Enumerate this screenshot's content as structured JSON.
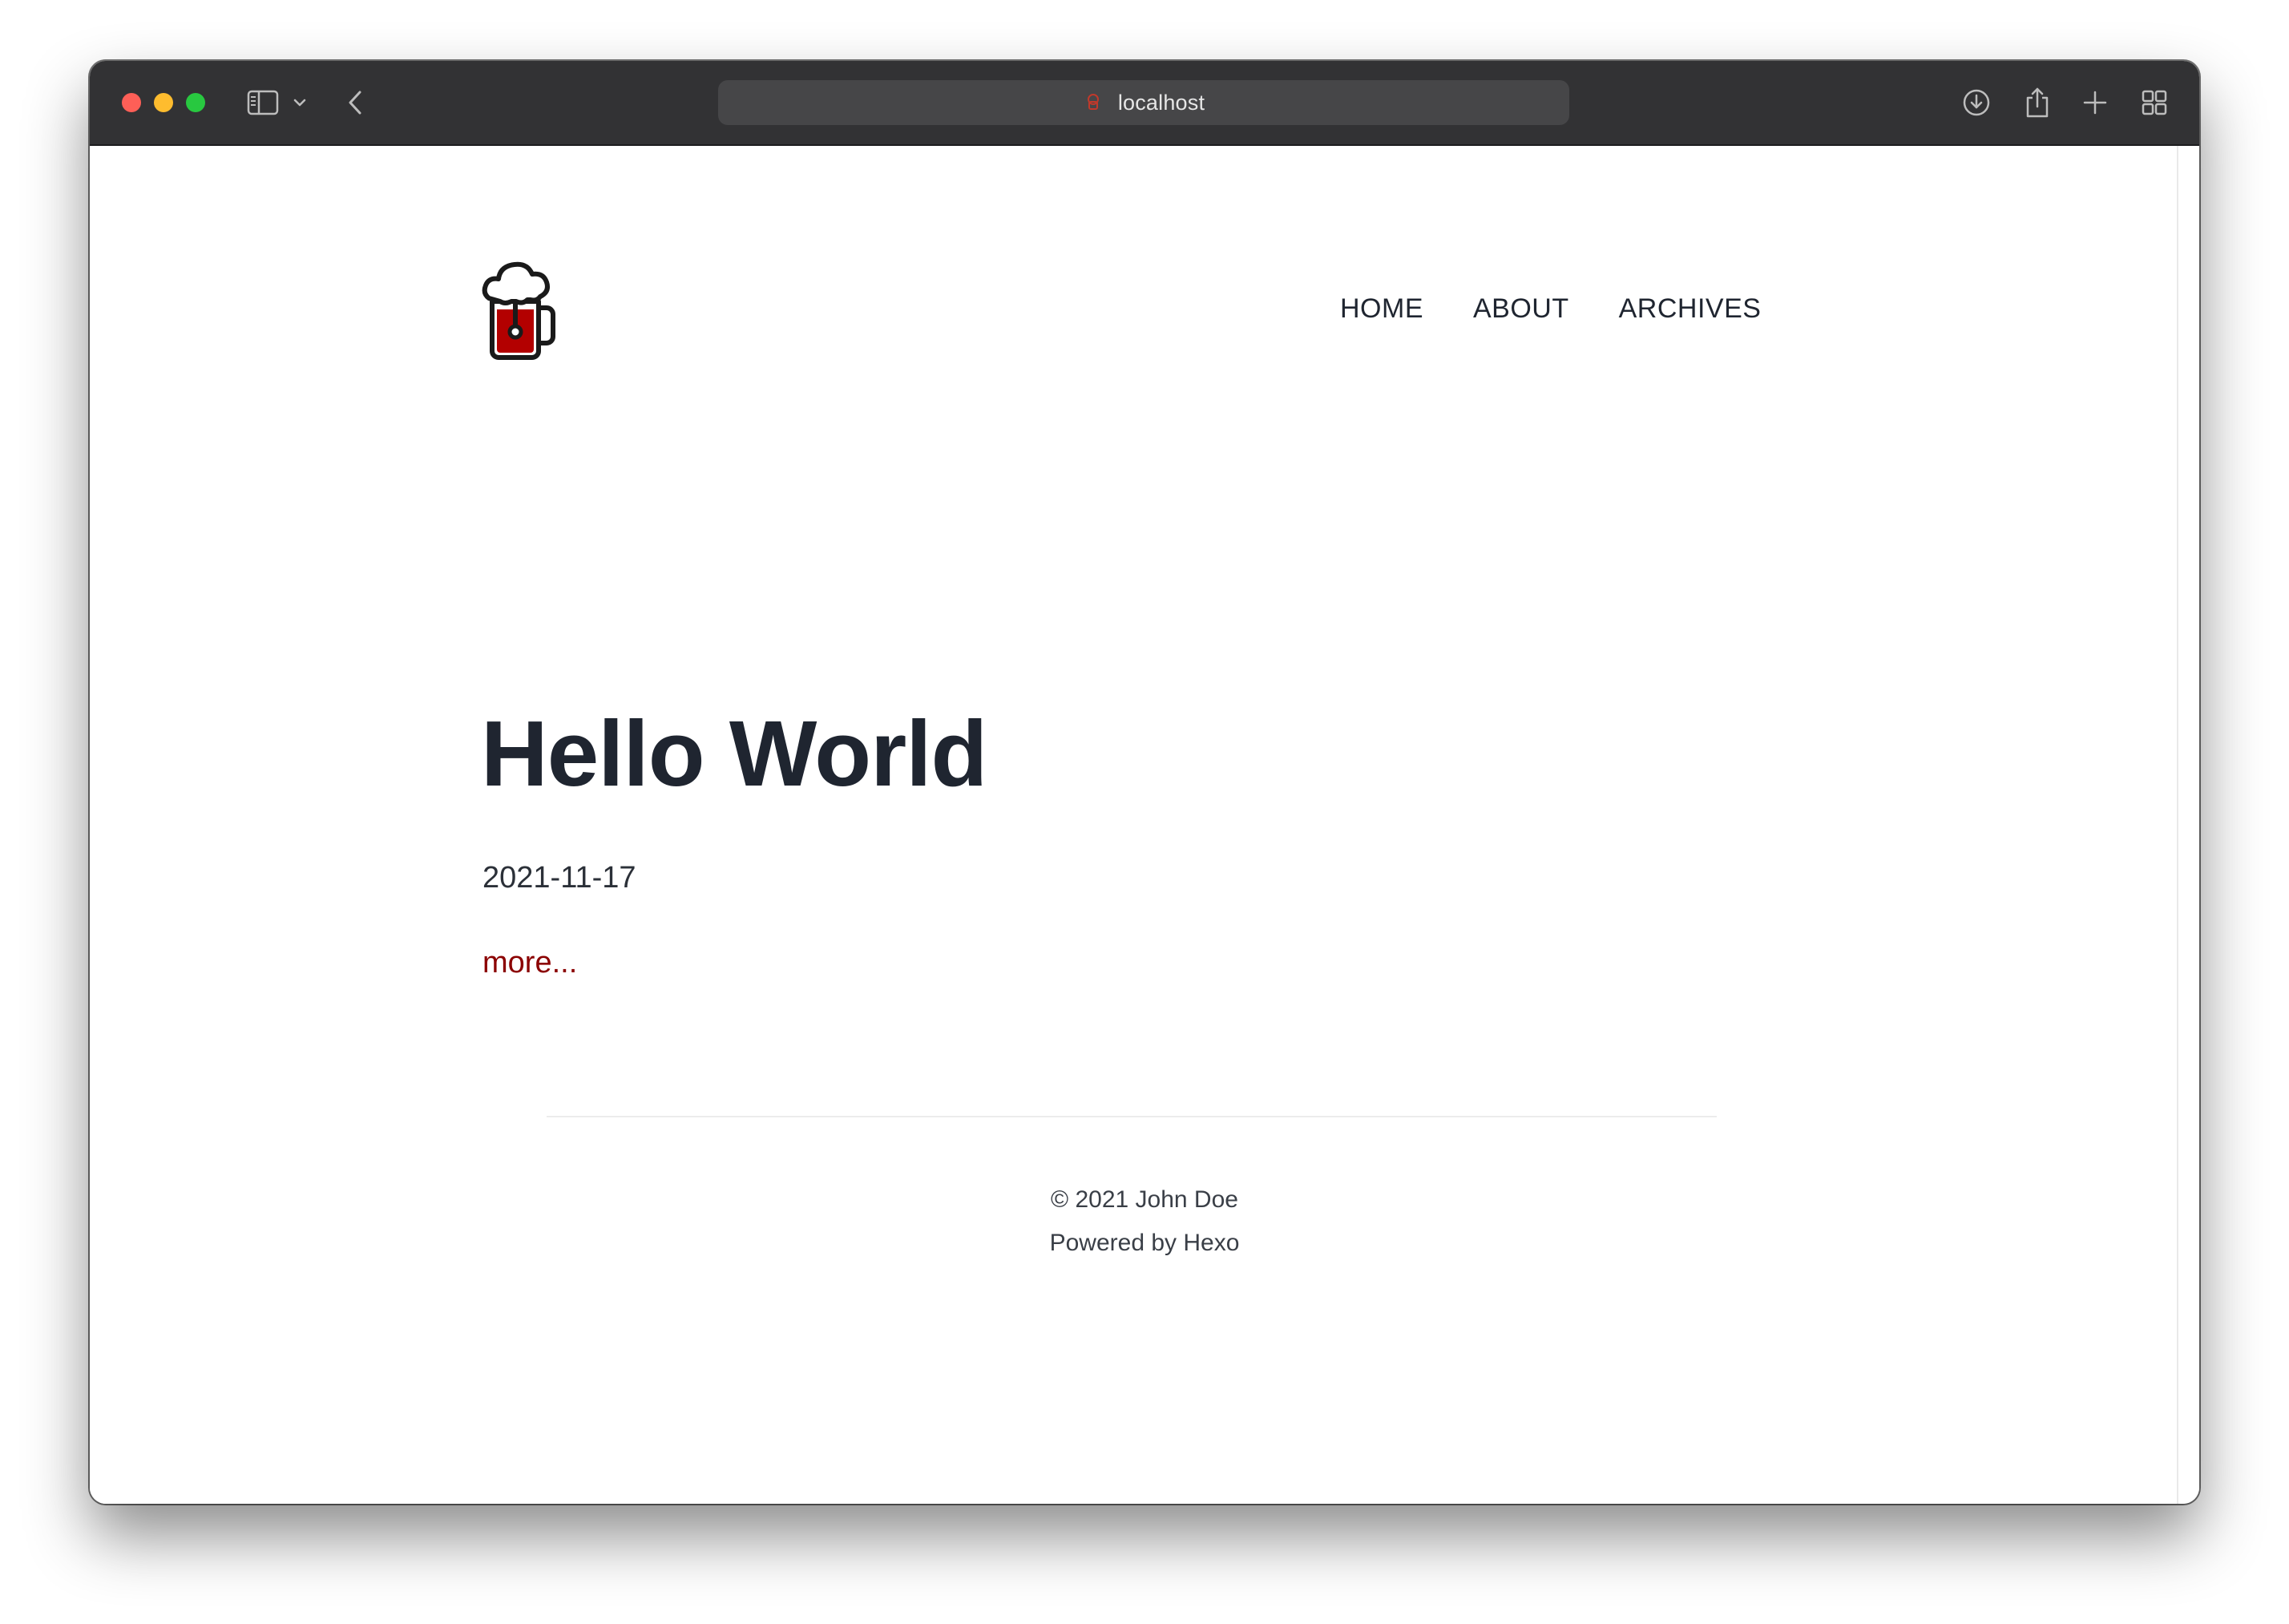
{
  "browser": {
    "url": "localhost",
    "icons": [
      "sidebar-icon",
      "chevron-down-icon",
      "back-icon",
      "download-icon",
      "share-icon",
      "new-tab-icon",
      "tab-overview-icon"
    ]
  },
  "site": {
    "nav": [
      {
        "label": "HOME"
      },
      {
        "label": "ABOUT"
      },
      {
        "label": "ARCHIVES"
      }
    ]
  },
  "post": {
    "title": "Hello World",
    "date": "2021-11-17",
    "more_label": "more..."
  },
  "footer": {
    "copyright": "© 2021 John Doe",
    "powered": "Powered by Hexo"
  },
  "colors": {
    "toolbar_bg": "#323234",
    "text": "#1f2530",
    "link": "#8b0000",
    "logo_fill": "#b30000"
  }
}
